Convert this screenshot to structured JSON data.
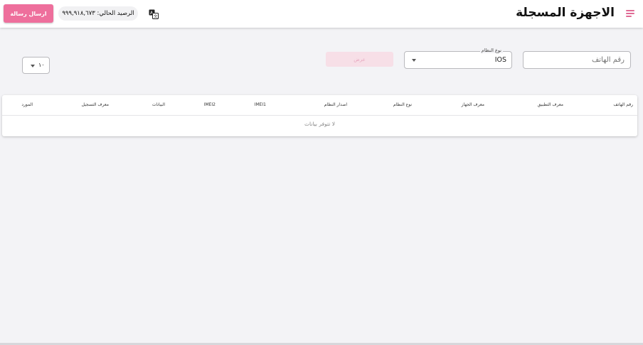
{
  "header": {
    "title": "الاجهزة المسجلة",
    "balance_text": "الرصيد الحالي: ٩٩٩,٩١٨,٦٧٣",
    "send_button": "ارسال رسالة",
    "menu_icon": "menu-icon",
    "translate_icon": "translate-icon"
  },
  "filters": {
    "phone_placeholder": "رقم الهاتف",
    "os_label": "نوع النظام",
    "os_value": "IOS",
    "show_button": "عرض"
  },
  "page_size": {
    "value": "١٠"
  },
  "table": {
    "columns": [
      "رقم الهاتف",
      "معرف التطبيق",
      "معرف الجهاز",
      "نوع النظام",
      "اصدار النظام",
      "IMEI1",
      "IMEI2",
      "البيانات",
      "معرف التسجيل",
      "المورد"
    ],
    "empty_message": "لا تتوفر بيانات"
  },
  "colors": {
    "accent": "#ee6f9c",
    "accent_light": "#f7dfe7",
    "background": "#f3f3f6"
  }
}
